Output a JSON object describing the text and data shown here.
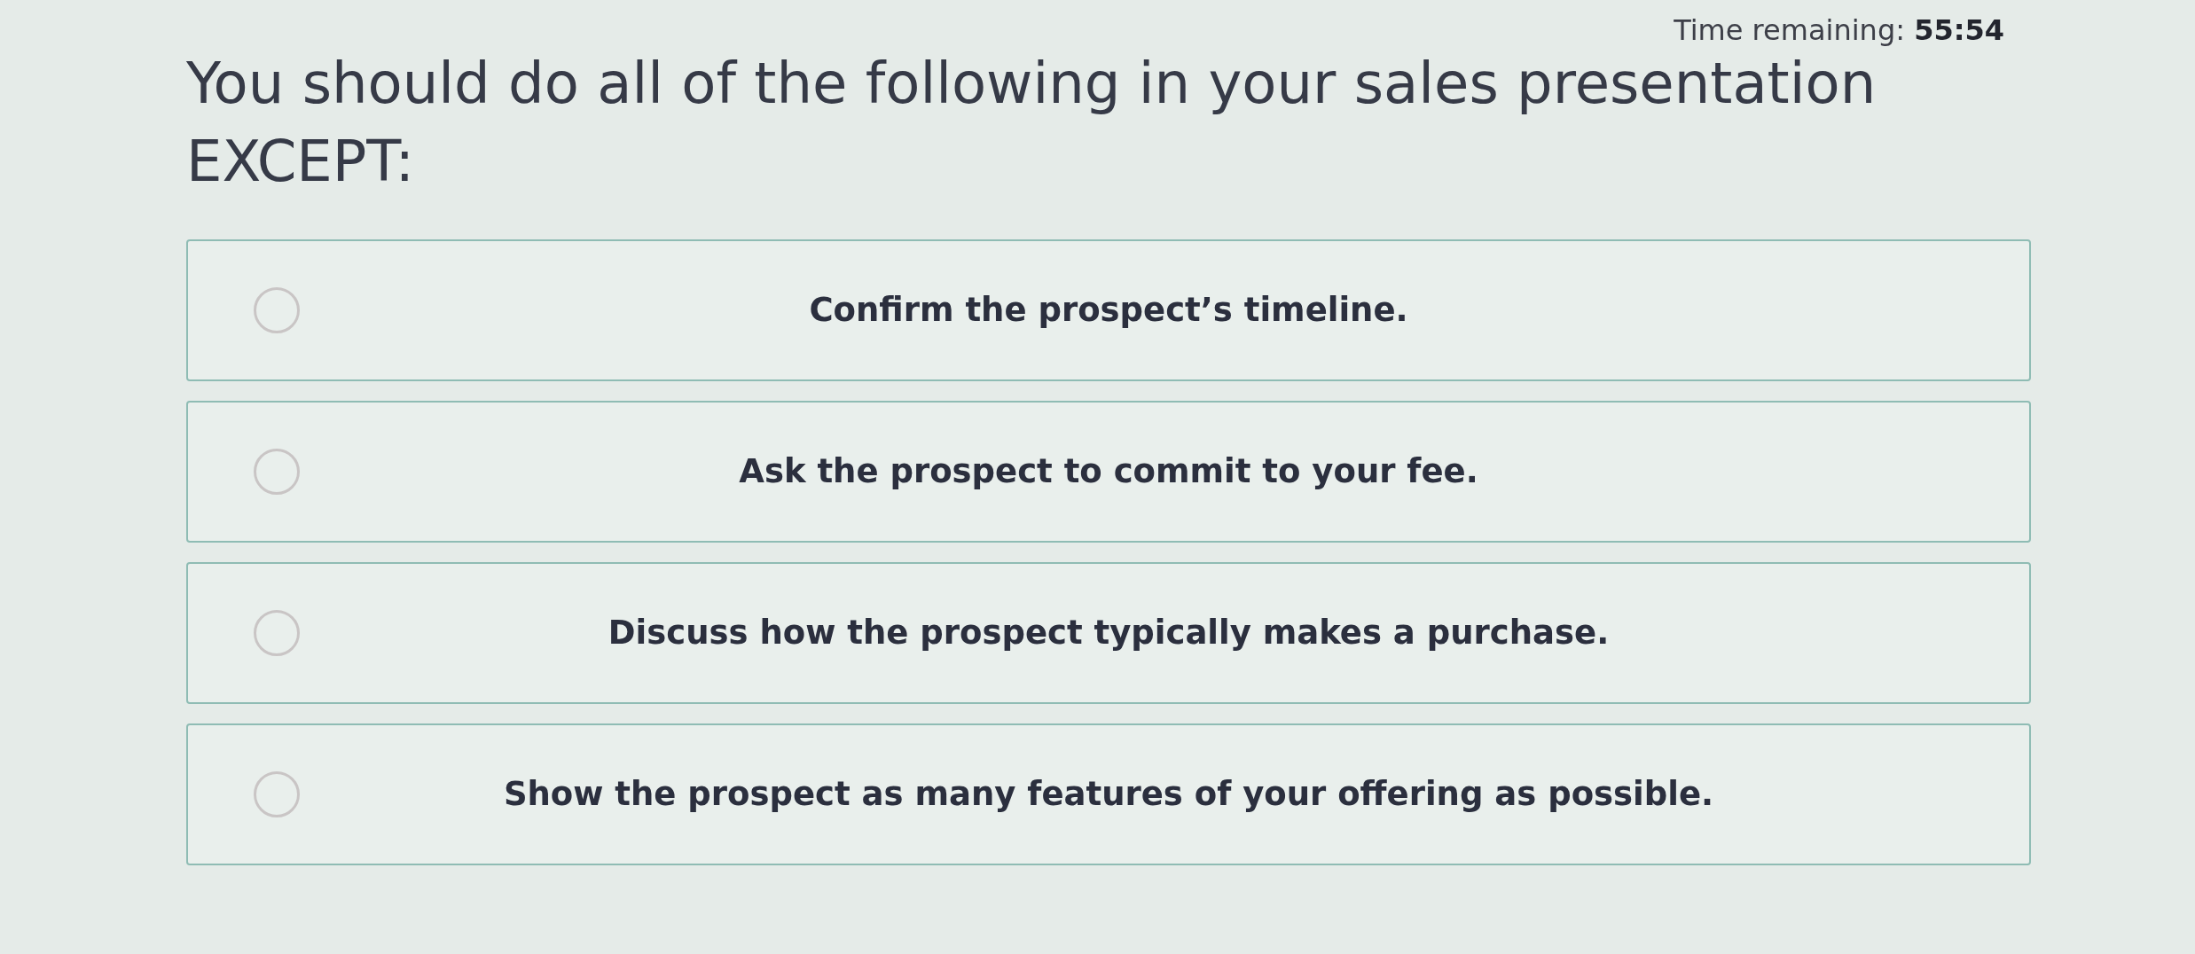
{
  "timer": {
    "text": "Time remaining: **55:54**"
  },
  "question": {
    "text": "You should do all of the following in your sales presentation EXCEPT:"
  },
  "options": [
    {
      "text": "Confirm the prospect’s timeline.",
      "selected": false
    },
    {
      "text": "Ask the prospect to commit to your fee.",
      "selected": false
    },
    {
      "text": "Discuss how the prospect typically makes a purchase.",
      "selected": false
    },
    {
      "text": "Show the prospect as many features of your offering as possible.",
      "selected": false
    }
  ]
}
